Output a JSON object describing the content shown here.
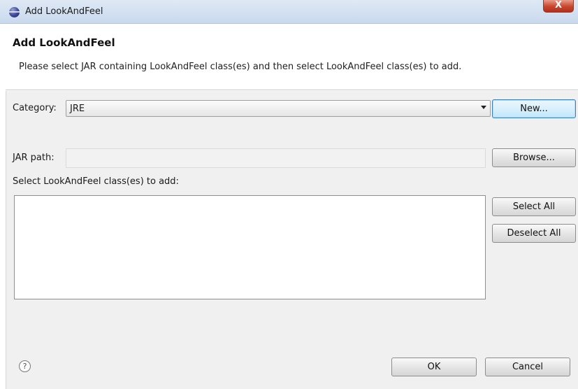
{
  "window": {
    "title": "Add LookAndFeel",
    "close_glyph": "X"
  },
  "banner": {
    "title": "Add LookAndFeel",
    "description": "Please select JAR containing LookAndFeel class(es) and then select LookAndFeel class(es) to add."
  },
  "category": {
    "label": "Category:",
    "selected": "JRE",
    "new_button": "New..."
  },
  "jar": {
    "label": "JAR path:",
    "value": "",
    "browse_button": "Browse..."
  },
  "classes": {
    "label": "Select LookAndFeel class(es) to add:",
    "items": [],
    "select_all_button": "Select All",
    "deselect_all_button": "Deselect All"
  },
  "footer": {
    "help_glyph": "?",
    "ok_button": "OK",
    "cancel_button": "Cancel"
  },
  "icons": {
    "app": "eclipse-icon",
    "help": "help-icon",
    "dropdown": "chevron-down-icon"
  },
  "colors": {
    "titlebar": "#c9d9ee",
    "dialog_body": "#f0f0f0",
    "default_button_border": "#3c7fb1",
    "close_button": "#c9452d"
  }
}
